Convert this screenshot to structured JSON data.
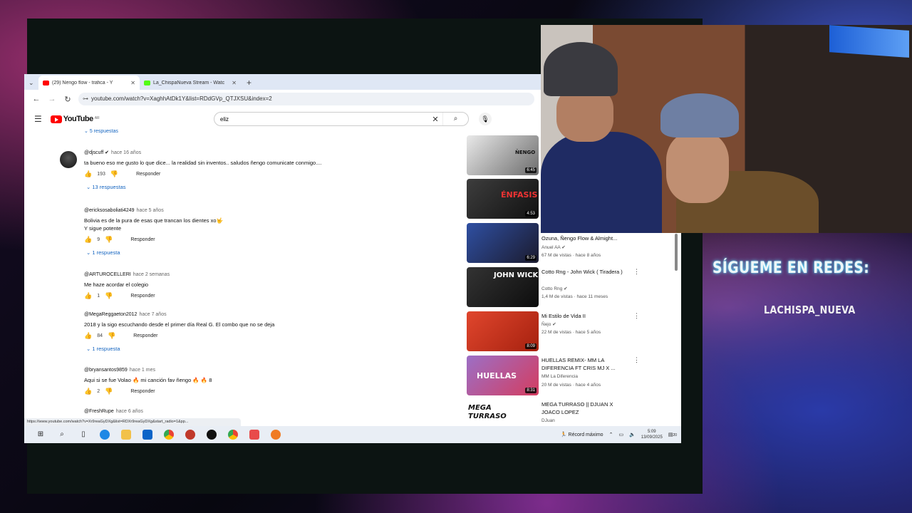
{
  "browser": {
    "tabs": [
      {
        "label": "(29) Ñengo flow - trafica - Y",
        "active": true,
        "favicon_color": "#ff0000"
      },
      {
        "label": "La_ChispaNueva Stream - Watc",
        "active": false,
        "favicon_color": "#53fc18"
      }
    ],
    "url": "youtube.com/watch?v=XaghhAtDk1Y&list=RDdGVp_QTJXSU&index=2",
    "hover_url": "https://www.youtube.com/watch?v=Xr9reaGyDXg&list=RDXr9reaGyDXg&start_radio=1&pp..."
  },
  "youtube": {
    "logo": "YouTube",
    "region": "AR",
    "search_value": "eliz",
    "top_replies": "5 respuestas",
    "comments": [
      {
        "author": "@djscuff",
        "time": "hace 16 años",
        "text": "ta bueno eso me gusto lo que dice... la realidad sin inventos.. saludos ñengo comunicate conmigo....",
        "likes": "193",
        "reply": "Responder",
        "replies": "13 respuestas"
      },
      {
        "author": "@ericksosaboliati4249",
        "time": "hace 5 años",
        "text": "Bolivia es de la pura de esas que trancan los dientes xo🤟",
        "text2": "Y sigue potente",
        "likes": "9",
        "reply": "Responder",
        "replies": "1 respuesta"
      },
      {
        "author": "@ARTUROCELLERI",
        "time": "hace 2 semanas",
        "text": "Me haze acordar el colegio",
        "likes": "1",
        "reply": "Responder"
      },
      {
        "author": "@MegaReggaeton2012",
        "time": "hace 7 años",
        "text": "2018 y la sigo escuchando desde el primer día Real G. El combo que no se deja",
        "likes": "84",
        "reply": "Responder",
        "replies": "1 respuesta"
      },
      {
        "author": "@bryansantos9859",
        "time": "hace 1 mes",
        "text": "Aqui si se fue Volao 🔥 mi canción fav ñengo 🔥 🔥 8",
        "likes": "2",
        "reply": "Responder"
      },
      {
        "author": "@FreshRupe",
        "time": "hace 6 años"
      }
    ],
    "videos": [
      {
        "duration": "6:45",
        "thumb_label": "ÑENGO",
        "thumb_color": "#cfcfcf"
      },
      {
        "duration": "4:53",
        "thumb_label": "ÉNFASIS",
        "thumb_color": "#2b2b2b"
      },
      {
        "duration": "6:29",
        "thumb_label": "",
        "thumb_color": "#2f4fa2",
        "title": "Ozuna, Ñengo Flow & Almight...",
        "channel": "Anuel AA",
        "meta": "67 M de vistas · hace 8 años"
      },
      {
        "duration": "",
        "thumb_label": "JOHN WICK",
        "thumb_color": "#1a1a1a",
        "title": "Cotto Rng - John Wick ( Tiradera )",
        "channel": "Cotto Rng",
        "meta": "1,4 M de vistas · hace 11 meses"
      },
      {
        "duration": "8:09",
        "thumb_label": "",
        "thumb_color": "#d23a25",
        "title": "Mi Estilo de Vida II",
        "channel": "Ñejo",
        "meta": "22 M de vistas · hace 5 años"
      },
      {
        "duration": "8:31",
        "thumb_label": "HUELLAS",
        "thumb_color": "#7a4fa0",
        "title": "HUELLAS REMIX- MM LA DIFERENCIA FT CRIS MJ X ...",
        "channel": "MM La Diferencia",
        "meta": "20 M de vistas · hace 4 años"
      },
      {
        "duration": "",
        "thumb_label": "MEGA TURRASO",
        "thumb_color": "#ffffff",
        "title": "MEGA TURRASO || DJUAN X JOACO LOPEZ",
        "channel": "DJuan",
        "meta": ""
      }
    ]
  },
  "taskbar": {
    "record": "Récord máximo",
    "time": "5:09",
    "date": "13/09/2025",
    "notif": "20"
  },
  "overlay": {
    "follow": "SÍGUEME EN REDES:",
    "handle": "LACHISPA_NUEVA"
  },
  "icons": [
    "search-icon",
    "mic-icon",
    "close-icon",
    "menu-icon",
    "like-icon",
    "dislike-icon",
    "kebab-icon",
    "windows-icon",
    "chrome-icon"
  ]
}
